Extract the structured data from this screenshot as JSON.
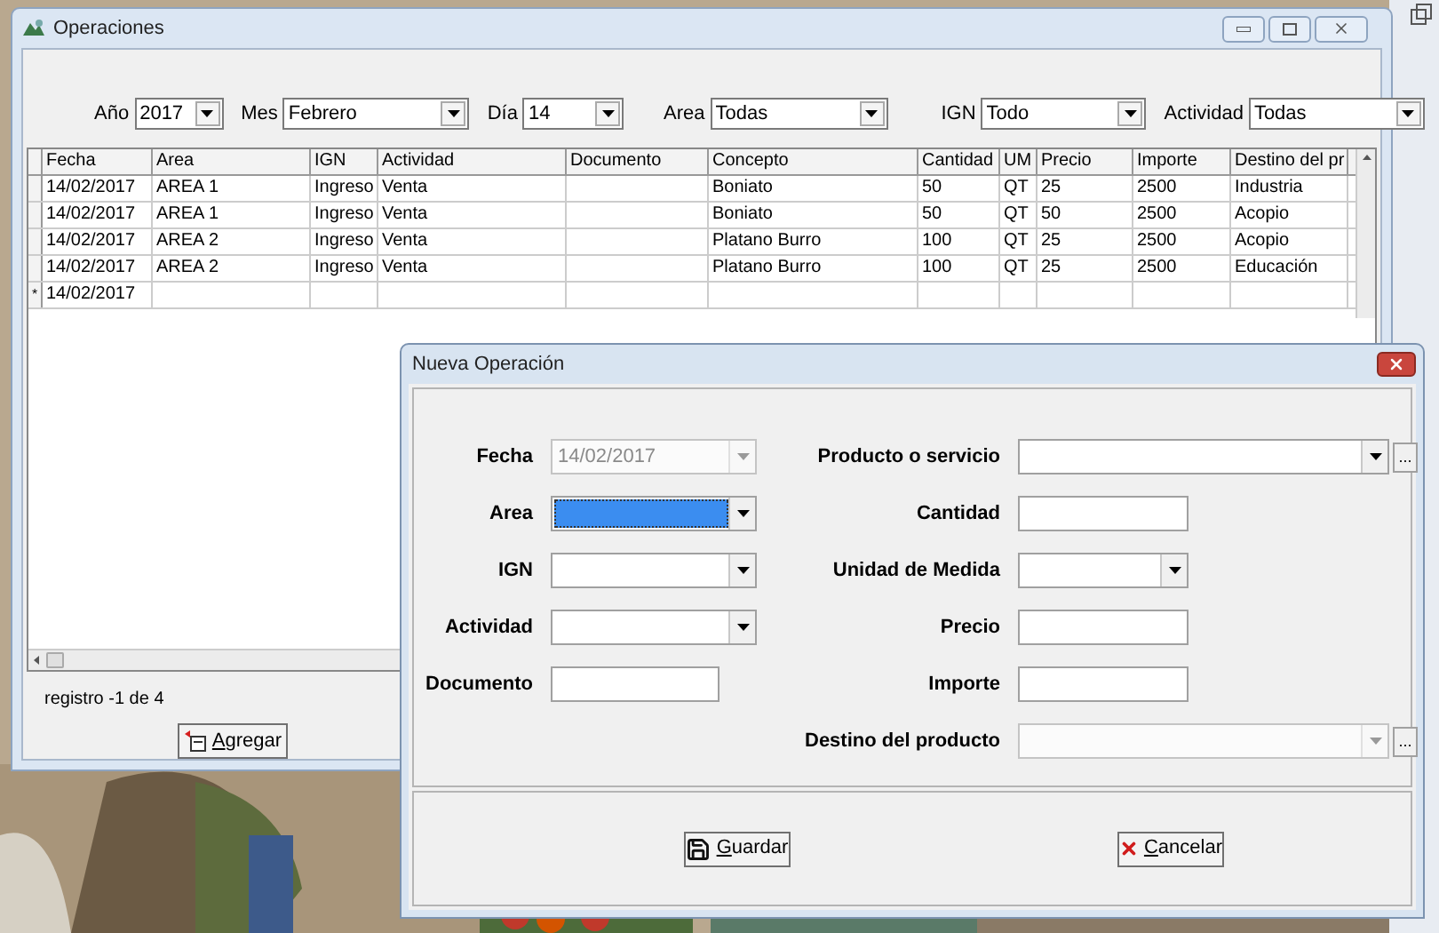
{
  "window": {
    "title": "Operaciones"
  },
  "filters": [
    {
      "label": "Año",
      "value": "2017"
    },
    {
      "label": "Mes",
      "value": "Febrero"
    },
    {
      "label": "Día",
      "value": "14"
    },
    {
      "label": "Area",
      "value": "Todas"
    },
    {
      "label": "IGN",
      "value": "Todo"
    },
    {
      "label": "Actividad",
      "value": "Todas"
    }
  ],
  "table": {
    "columns": [
      "Fecha",
      "Area",
      "IGN",
      "Actividad",
      "Documento",
      "Concepto",
      "Cantidad",
      "UM",
      "Precio",
      "Importe",
      "Destino del pr"
    ],
    "rows": [
      {
        "cells": [
          "14/02/2017",
          "AREA 1",
          "Ingreso",
          "Venta",
          "",
          "Boniato",
          "50",
          "QT",
          "25",
          "2500",
          "Industria"
        ]
      },
      {
        "cells": [
          "14/02/2017",
          "AREA 1",
          "Ingreso",
          "Venta",
          "",
          "Boniato",
          "50",
          "QT",
          "50",
          "2500",
          "Acopio"
        ]
      },
      {
        "cells": [
          "14/02/2017",
          "AREA 2",
          "Ingreso",
          "Venta",
          "",
          "Platano Burro",
          "100",
          "QT",
          "25",
          "2500",
          "Acopio"
        ]
      },
      {
        "cells": [
          "14/02/2017",
          "AREA 2",
          "Ingreso",
          "Venta",
          "",
          "Platano Burro",
          "100",
          "QT",
          "25",
          "2500",
          "Educación"
        ]
      },
      {
        "marker": "*",
        "cells": [
          "14/02/2017",
          "",
          "",
          "",
          "",
          "",
          "",
          "",
          "",
          "",
          ""
        ]
      }
    ]
  },
  "status": "registro -1 de 4",
  "add_button": "Agregar",
  "dialog": {
    "title": "Nueva Operación",
    "left": [
      {
        "label": "Fecha",
        "kind": "combo",
        "value": "14/02/2017",
        "disabled": true,
        "focused": false
      },
      {
        "label": "Area",
        "kind": "combo",
        "disabled": false,
        "focused": true
      },
      {
        "label": "IGN",
        "kind": "combo",
        "disabled": false,
        "focused": false
      },
      {
        "label": "Actividad",
        "kind": "combo",
        "disabled": false,
        "focused": false
      },
      {
        "label": "Documento",
        "kind": "text",
        "focused": false
      }
    ],
    "right": [
      {
        "label": "Producto o servicio",
        "kind": "combo",
        "browse": "...",
        "disabled": false,
        "focused": false
      },
      {
        "label": "Cantidad",
        "kind": "text",
        "focused": false
      },
      {
        "label": "Unidad de Medida",
        "kind": "combo",
        "disabled": false,
        "focused": false
      },
      {
        "label": "Precio",
        "kind": "text",
        "focused": false
      },
      {
        "label": "Importe",
        "kind": "text",
        "focused": false
      },
      {
        "label": "Destino del producto",
        "kind": "combo",
        "browse": "...",
        "disabled": true,
        "focused": false
      }
    ],
    "buttons": [
      {
        "label": "Guardar",
        "kind": "save"
      },
      {
        "label": "Cancelar",
        "kind": "cancel"
      }
    ]
  }
}
